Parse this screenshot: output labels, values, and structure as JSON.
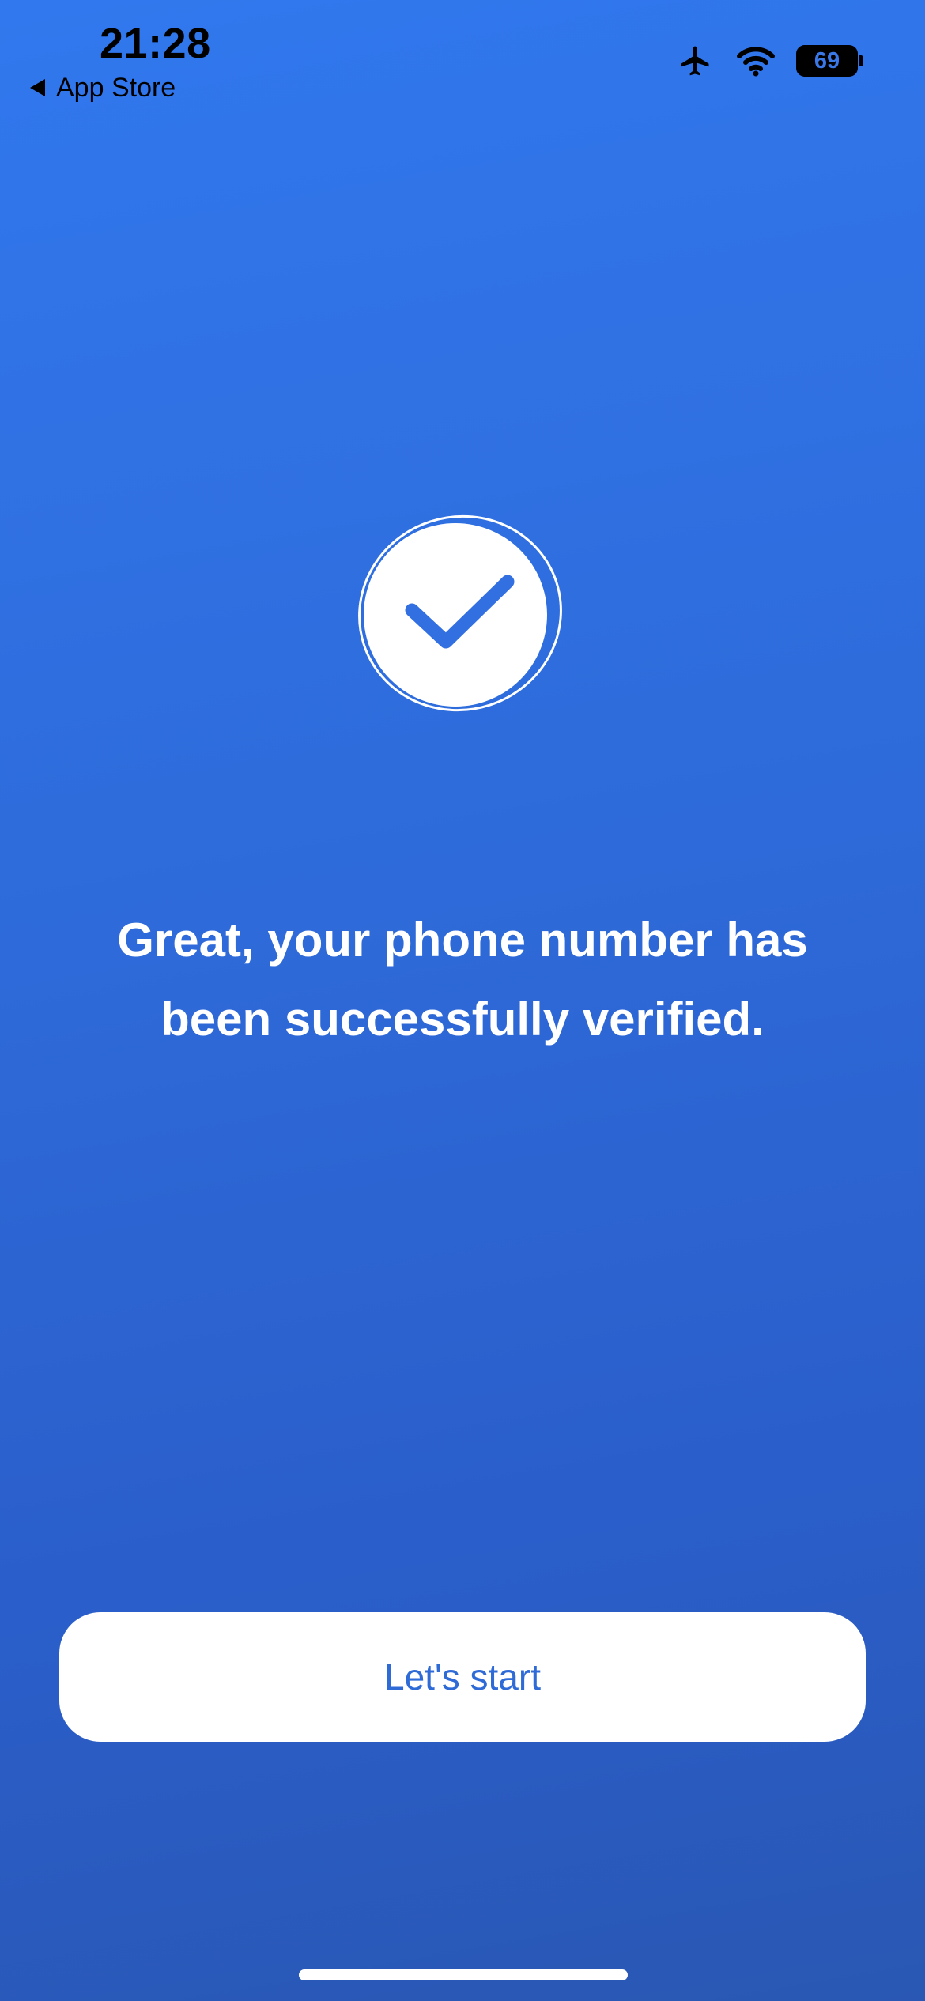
{
  "status_bar": {
    "time": "21:28",
    "back_app": "App Store",
    "battery_level": "69",
    "icons": [
      "airplane-mode-icon",
      "wifi-icon",
      "battery-icon"
    ]
  },
  "verification": {
    "icon": "checkmark-circle-icon",
    "message_line1": "Great, your phone number has",
    "message_line2": "been successfully verified."
  },
  "actions": {
    "start_label": "Let's start"
  },
  "colors": {
    "background_top": "#3178ee",
    "background_bottom": "#2957b3",
    "accent": "#2f6bd6",
    "button_bg": "#ffffff",
    "text": "#ffffff"
  }
}
